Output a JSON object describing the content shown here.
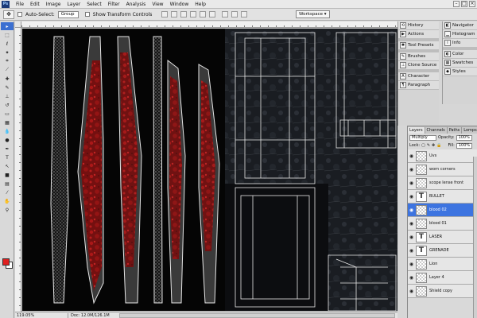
{
  "menubar": {
    "logo": "Ps",
    "items": [
      "File",
      "Edit",
      "Image",
      "Layer",
      "Select",
      "Filter",
      "Analysis",
      "View",
      "Window",
      "Help"
    ]
  },
  "options": {
    "auto_select_label": "Auto-Select:",
    "auto_select_value": "Group",
    "transform_label": "Show Transform Controls",
    "workspace_label": "Workspace"
  },
  "dock": {
    "col_a": [
      "History",
      "Actions",
      "Tool Presets",
      "Brushes",
      "Clone Source",
      "Character",
      "Paragraph"
    ],
    "col_b": [
      "Navigator",
      "Histogram",
      "Info",
      "Color",
      "Swatches",
      "Styles"
    ]
  },
  "layers_panel": {
    "tabs": [
      "Layers",
      "Channels",
      "Paths",
      "Lomps"
    ],
    "blend_mode": "Multiply",
    "opacity_label": "Opacity:",
    "opacity_value": "100%",
    "lock_label": "Lock:",
    "fill_label": "Fill:",
    "fill_value": "100%",
    "layers": [
      {
        "name": "Uvs",
        "type": "raster",
        "selected": false
      },
      {
        "name": "worn corners",
        "type": "raster",
        "selected": false
      },
      {
        "name": "scope lense front",
        "type": "raster",
        "selected": false
      },
      {
        "name": "BULLET",
        "type": "text",
        "selected": false
      },
      {
        "name": "blood 02",
        "type": "raster",
        "selected": true
      },
      {
        "name": "blood 01",
        "type": "raster",
        "selected": false
      },
      {
        "name": "LASER",
        "type": "text",
        "selected": false
      },
      {
        "name": "GRENADE",
        "type": "text",
        "selected": false
      },
      {
        "name": "Lion",
        "type": "raster",
        "selected": false
      },
      {
        "name": "Layer 4",
        "type": "raster",
        "selected": false
      },
      {
        "name": "Shield copy",
        "type": "raster",
        "selected": false
      }
    ]
  },
  "status": {
    "zoom": "119.05%",
    "doc_size": "Doc: 12.0M/126.1M"
  },
  "colors": {
    "foreground": "#e02020",
    "background": "#ffffff",
    "selection": "#3d74e0"
  },
  "toolbox": {
    "icons": [
      "move-icon",
      "marquee-icon",
      "lasso-icon",
      "magic-wand-icon",
      "crop-icon",
      "slice-icon",
      "healing-icon",
      "brush-icon",
      "stamp-icon",
      "history-brush-icon",
      "eraser-icon",
      "gradient-icon",
      "blur-icon",
      "dodge-icon",
      "pen-icon",
      "type-icon",
      "path-select-icon",
      "shape-icon",
      "notes-icon",
      "eyedropper-icon",
      "hand-icon",
      "zoom-icon"
    ]
  }
}
